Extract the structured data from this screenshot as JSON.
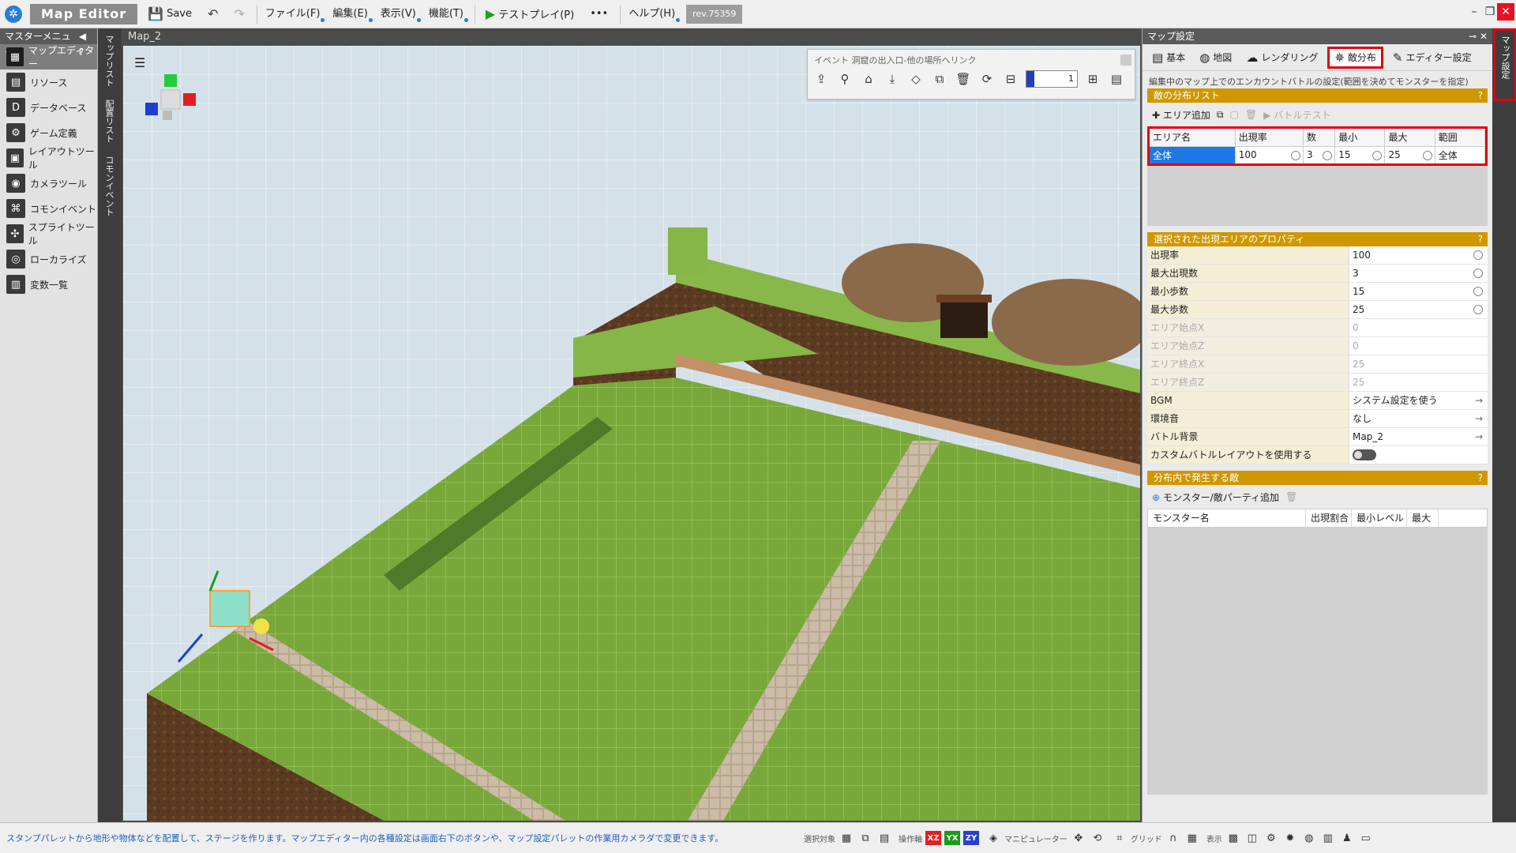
{
  "app": {
    "title": "Map Editor",
    "save_label": "Save",
    "menus": [
      "ファイル(F)",
      "編集(E)",
      "表示(V)",
      "機能(T)"
    ],
    "testplay_label": "テストプレイ(P)",
    "more_label": "•••",
    "help_label": "ヘルプ(H)",
    "revision": "rev.75359"
  },
  "left_menu": {
    "header": "マスターメニュー",
    "help_glyph": "?",
    "items": [
      {
        "label": "マップエディター",
        "icon": "map-editor-icon",
        "glyph": "▦",
        "active": true
      },
      {
        "label": "リソース",
        "icon": "resource-icon",
        "glyph": "▤",
        "active": false
      },
      {
        "label": "データベース",
        "icon": "database-icon",
        "glyph": "D",
        "active": false
      },
      {
        "label": "ゲーム定義",
        "icon": "game-definition-icon",
        "glyph": "⚙",
        "active": false
      },
      {
        "label": "レイアウトツール",
        "icon": "layout-tool-icon",
        "glyph": "▣",
        "active": false
      },
      {
        "label": "カメラツール",
        "icon": "camera-tool-icon",
        "glyph": "◉",
        "active": false
      },
      {
        "label": "コモンイベント",
        "icon": "common-event-icon",
        "glyph": "⌘",
        "active": false
      },
      {
        "label": "スプライトツール",
        "icon": "sprite-tool-icon",
        "glyph": "✣",
        "active": false
      },
      {
        "label": "ローカライズ",
        "icon": "localize-icon",
        "glyph": "◎",
        "active": false
      },
      {
        "label": "変数一覧",
        "icon": "variable-list-icon",
        "glyph": "▥",
        "active": false
      }
    ]
  },
  "vertical_tabs": [
    "マップリスト",
    "配置リスト",
    "コモンイベント"
  ],
  "viewport": {
    "title": "Map_2",
    "event_toolbar_label": "イベント 洞窟の出入口-他の場所へリンク",
    "event_value": "1"
  },
  "right_panel": {
    "header": "マップ設定",
    "tabs": [
      {
        "label": "基本",
        "icon": "basic-icon",
        "glyph": "▤",
        "active": false
      },
      {
        "label": "地図",
        "icon": "map-icon",
        "glyph": "◍",
        "active": false
      },
      {
        "label": "レンダリング",
        "icon": "rendering-icon",
        "glyph": "☁",
        "active": false
      },
      {
        "label": "敵分布",
        "icon": "enemy-distribution-icon",
        "glyph": "✵",
        "active": true
      },
      {
        "label": "エディター設定",
        "icon": "editor-settings-icon",
        "glyph": "✎",
        "active": false
      }
    ],
    "description": "編集中のマップ上でのエンカウントバトルの設定(範囲を決めてモンスターを指定)",
    "dist_section_title": "敵の分布リスト",
    "add_area_label": "エリア追加",
    "battle_test_label": "バトルテスト",
    "dist_columns": [
      "エリア名",
      "出現率",
      "数",
      "最小",
      "最大",
      "範囲"
    ],
    "dist_rows": [
      [
        "全体",
        "100",
        "3",
        "15",
        "25",
        "全体"
      ]
    ],
    "props_section_title": "選択された出現エリアのプロパティ",
    "props": [
      {
        "name": "出現率",
        "value": "100",
        "kind": "spin",
        "dim": false
      },
      {
        "name": "最大出現数",
        "value": "3",
        "kind": "spin",
        "dim": false
      },
      {
        "name": "最小歩数",
        "value": "15",
        "kind": "spin",
        "dim": false
      },
      {
        "name": "最大歩数",
        "value": "25",
        "kind": "spin",
        "dim": false
      },
      {
        "name": "エリア始点X",
        "value": "0",
        "kind": "text",
        "dim": true
      },
      {
        "name": "エリア始点Z",
        "value": "0",
        "kind": "text",
        "dim": true
      },
      {
        "name": "エリア終点X",
        "value": "25",
        "kind": "text",
        "dim": true
      },
      {
        "name": "エリア終点Z",
        "value": "25",
        "kind": "text",
        "dim": true
      },
      {
        "name": "BGM",
        "value": "システム設定を使う",
        "kind": "link",
        "dim": false
      },
      {
        "name": "環境音",
        "value": "なし",
        "kind": "link",
        "dim": false
      },
      {
        "name": "バトル背景",
        "value": "Map_2",
        "kind": "link",
        "dim": false
      },
      {
        "name": "カスタムバトルレイアウトを使用する",
        "value": "",
        "kind": "toggle",
        "dim": false
      }
    ],
    "monster_section_title": "分布内で発生する敵",
    "add_monster_label": "モンスター/敵パーティ追加",
    "monster_columns": [
      "モンスター名",
      "出現割合",
      "最小レベル",
      "最大"
    ],
    "side_tab": "マップ設定"
  },
  "statusbar": {
    "message": "スタンプパレットから地形や物体などを配置して、ステージを作ります。マップエディター内の各種設定は画面右下のボタンや、マップ設定パレットの作業用カメラダで変更できます。",
    "select_target_label": "選択対象",
    "operation_axis_label": "操作軸",
    "axis_badges": [
      {
        "text": "XZ",
        "color": "#e02020"
      },
      {
        "text": "YX",
        "color": "#1a9b1a"
      },
      {
        "text": "ZY",
        "color": "#2a40c8"
      }
    ],
    "manipulator_label": "マニピュレーター",
    "grid_label": "グリッド",
    "display_label": "表示"
  },
  "colors": {
    "accent_section": "#cf9700",
    "highlight_red": "#e10010",
    "selection_blue": "#1e78e6"
  }
}
